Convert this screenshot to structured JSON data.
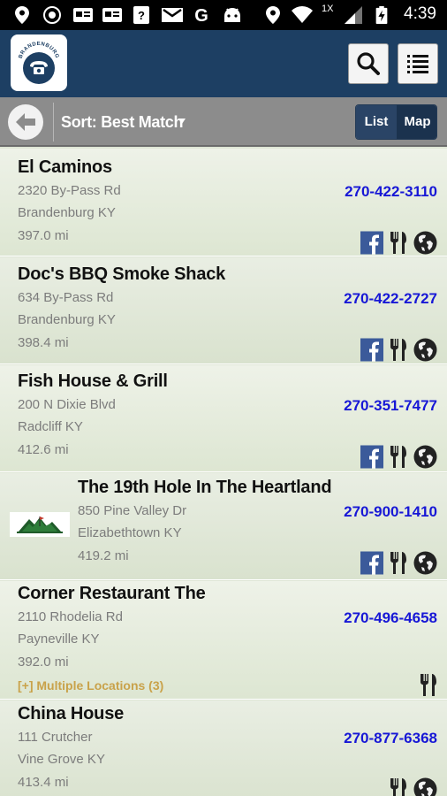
{
  "status_bar": {
    "time": "4:39",
    "network_label": "1X",
    "icons": [
      "location-icon",
      "shield-icon",
      "card-icon",
      "card-icon",
      "question-icon",
      "mail-icon",
      "g-icon",
      "android-icon",
      "location-icon",
      "wifi-icon",
      "signal-icon",
      "battery-charging-icon"
    ]
  },
  "app_bar": {
    "logo_text": "BRANDENBURG",
    "logo_icon": "telephone-icon",
    "search_icon": "search-icon",
    "menu_icon": "list-icon"
  },
  "sort_bar": {
    "back_icon": "back-arrow-icon",
    "sort_label": "Sort: Best Match",
    "tabs": [
      {
        "label": "List"
      },
      {
        "label": "Map"
      }
    ]
  },
  "results": [
    {
      "name": "El Caminos",
      "address": "2320 By-Pass Rd",
      "city": "Brandenburg KY",
      "distance": "397.0 mi",
      "phone": "270-422-3110",
      "icons": [
        "facebook-icon",
        "restaurant-icon",
        "globe-icon"
      ]
    },
    {
      "name": "Doc's BBQ Smoke Shack",
      "address": "634 By-Pass Rd",
      "city": "Brandenburg KY",
      "distance": "398.4 mi",
      "phone": "270-422-2727",
      "icons": [
        "facebook-icon",
        "restaurant-icon",
        "globe-icon"
      ]
    },
    {
      "name": "Fish House & Grill",
      "address": "200 N Dixie Blvd",
      "city": "Radcliff KY",
      "distance": "412.6 mi",
      "phone": "270-351-7477",
      "icons": [
        "facebook-icon",
        "restaurant-icon",
        "globe-icon"
      ]
    },
    {
      "name": "The 19th Hole In The Heartland",
      "address": "850 Pine Valley Dr",
      "city": "Elizabethtown KY",
      "distance": "419.2 mi",
      "phone": "270-900-1410",
      "icons": [
        "facebook-icon",
        "restaurant-icon",
        "globe-icon"
      ],
      "thumbnail": "golf-logo"
    },
    {
      "name": "Corner Restaurant The",
      "address": "2110 Rhodelia Rd",
      "city": "Payneville KY",
      "distance": "392.0 mi",
      "phone": "270-496-4658",
      "multi": "[+] Multiple Locations (3)",
      "icons": [
        "restaurant-icon"
      ]
    },
    {
      "name": "China House",
      "address": "111 Crutcher",
      "city": "Vine Grove KY",
      "distance": "413.4 mi",
      "phone": "270-877-6368",
      "icons": [
        "restaurant-icon",
        "globe-icon"
      ]
    }
  ],
  "colors": {
    "header": "#1d3f63",
    "sort_bar": "#8c8c8c",
    "phone": "#1717d6",
    "multi_locations": "#c9a24a",
    "facebook": "#3b5a9a"
  }
}
